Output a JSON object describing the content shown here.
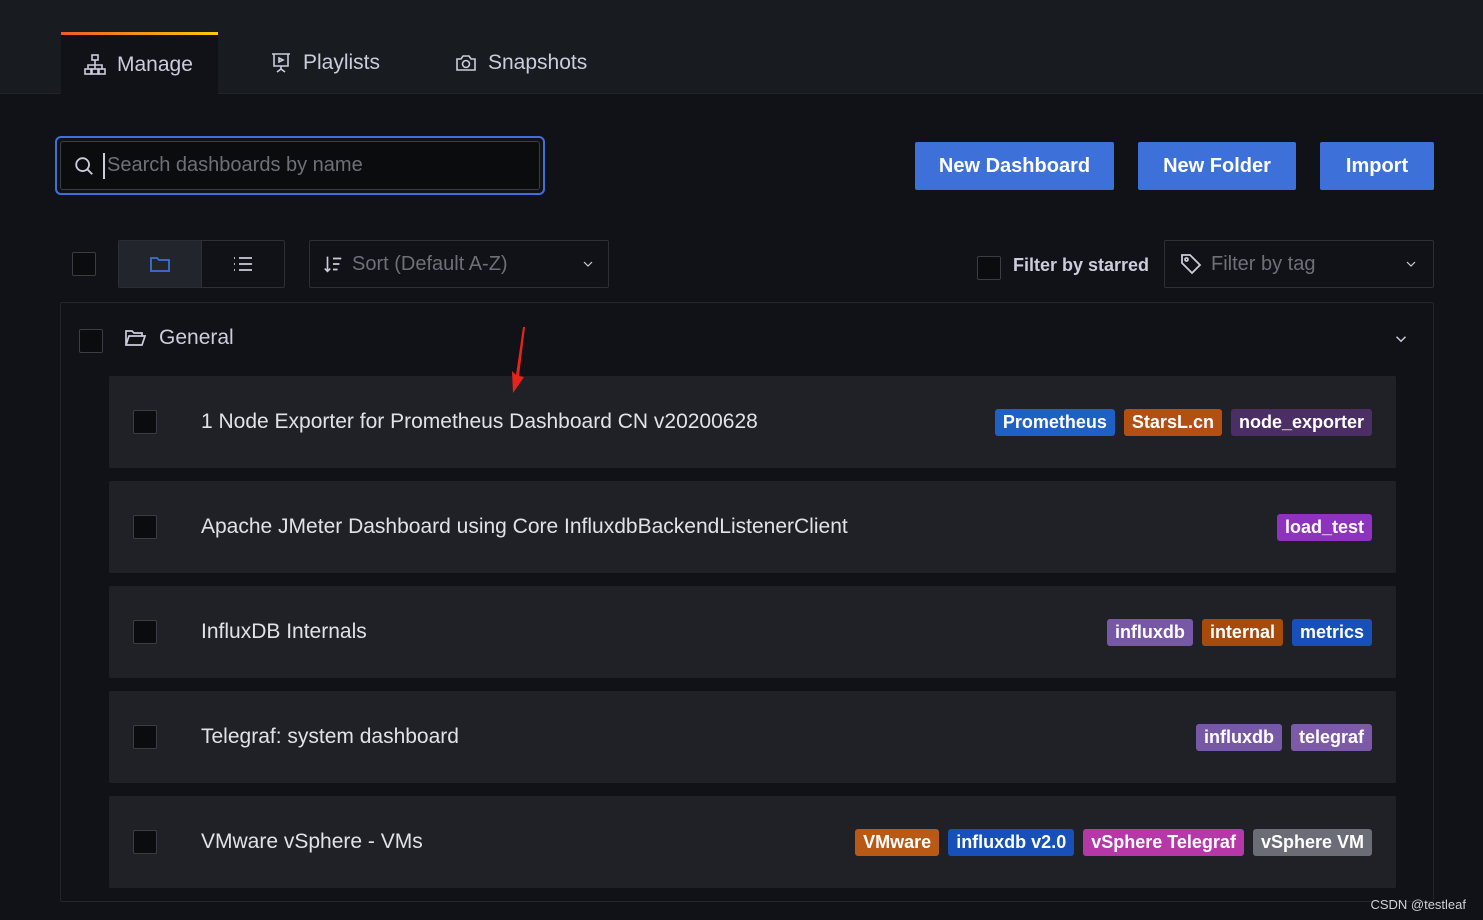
{
  "tabs": [
    {
      "label": "Manage",
      "icon": "sitemap-icon",
      "active": true
    },
    {
      "label": "Playlists",
      "icon": "presentation-play-icon",
      "active": false
    },
    {
      "label": "Snapshots",
      "icon": "camera-icon",
      "active": false
    }
  ],
  "search": {
    "placeholder": "Search dashboards by name",
    "value": ""
  },
  "actions": {
    "new_dashboard": "New Dashboard",
    "new_folder": "New Folder",
    "import": "Import"
  },
  "toolbar": {
    "sort_label": "Sort (Default A-Z)",
    "filter_starred_label": "Filter by starred",
    "filter_tag_placeholder": "Filter by tag",
    "view_mode": "folders"
  },
  "folder": {
    "name": "General",
    "expanded": true
  },
  "dashboards": [
    {
      "title": "1 Node Exporter for Prometheus Dashboard CN v20200628",
      "tags": [
        {
          "label": "Prometheus",
          "color": "#1f60c4"
        },
        {
          "label": "StarsL.cn",
          "color": "#b24f12"
        },
        {
          "label": "node_exporter",
          "color": "#4b2e63"
        }
      ]
    },
    {
      "title": "Apache JMeter Dashboard using Core InfluxdbBackendListenerClient",
      "tags": [
        {
          "label": "load_test",
          "color": "#8e33bd"
        }
      ]
    },
    {
      "title": "InfluxDB Internals",
      "tags": [
        {
          "label": "influxdb",
          "color": "#7658a6"
        },
        {
          "label": "internal",
          "color": "#a64b0c"
        },
        {
          "label": "metrics",
          "color": "#1650b8"
        }
      ]
    },
    {
      "title": "Telegraf: system dashboard",
      "tags": [
        {
          "label": "influxdb",
          "color": "#7658a6"
        },
        {
          "label": "telegraf",
          "color": "#7d5aa8"
        }
      ]
    },
    {
      "title": "VMware vSphere - VMs",
      "tags": [
        {
          "label": "VMware",
          "color": "#b85a15"
        },
        {
          "label": "influxdb v2.0",
          "color": "#1650b8"
        },
        {
          "label": "vSphere Telegraf",
          "color": "#b537a8"
        },
        {
          "label": "vSphere VM",
          "color": "#6a6d75"
        }
      ]
    }
  ],
  "watermark": "CSDN @testleaf",
  "colors": {
    "primary": "#3d71d9",
    "background": "#111217",
    "panel": "#1f2127",
    "annotation_arrow": "#e8231b"
  }
}
